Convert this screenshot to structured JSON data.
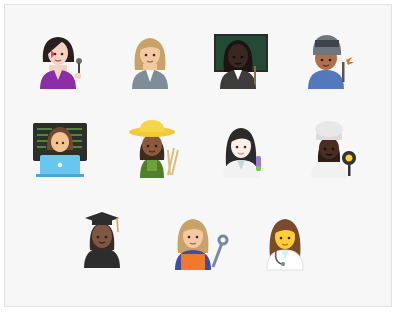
{
  "title": "",
  "emoji": [
    {
      "name": "woman-singer",
      "skin": "#f6d2c0",
      "hair": "#2a1f1f",
      "accessory": "microphone",
      "outfit": "#8a2ea5"
    },
    {
      "name": "woman-office-worker",
      "skin": "#f2c9a0",
      "hair": "#c9a26a",
      "accessory": "suit",
      "outfit": "#7e8e99"
    },
    {
      "name": "woman-teacher",
      "skin": "#3a2622",
      "hair": "#1d1412",
      "accessory": "chalkboard",
      "outfit": "#3e3b3b"
    },
    {
      "name": "woman-welder",
      "skin": "#b06f4d",
      "hair": "#4f3b33",
      "accessory": "welding-mask",
      "outfit": "#5478bc"
    },
    {
      "name": "woman-technologist",
      "skin": "#f3c391",
      "hair": "#6e4a34",
      "accessory": "laptop",
      "outfit": "#68c6f0"
    },
    {
      "name": "woman-farmer",
      "skin": "#8b5a3c",
      "hair": "#3c2a20",
      "accessory": "straw-hat",
      "outfit": "#4f7f2a"
    },
    {
      "name": "woman-scientist",
      "skin": "#fdeee6",
      "hair": "#2a2a2a",
      "accessory": "test-tube",
      "outfit": "#f2f2f2"
    },
    {
      "name": "woman-cook",
      "skin": "#4a2d22",
      "hair": "#2d1d18",
      "accessory": "chef-hat",
      "outfit": "#f1f1f1"
    },
    {
      "name": "woman-student",
      "skin": "#7e5642",
      "hair": "#3a2a25",
      "accessory": "graduation-cap",
      "outfit": "#2d2d2d"
    },
    {
      "name": "woman-mechanic",
      "skin": "#f2c9a0",
      "hair": "#c9a26a",
      "accessory": "wrench",
      "outfit": "#3e4ea5"
    },
    {
      "name": "woman-health-worker",
      "skin": "#ffcd38",
      "hair": "#7a4b2b",
      "accessory": "stethoscope",
      "outfit": "#ffffff"
    }
  ]
}
